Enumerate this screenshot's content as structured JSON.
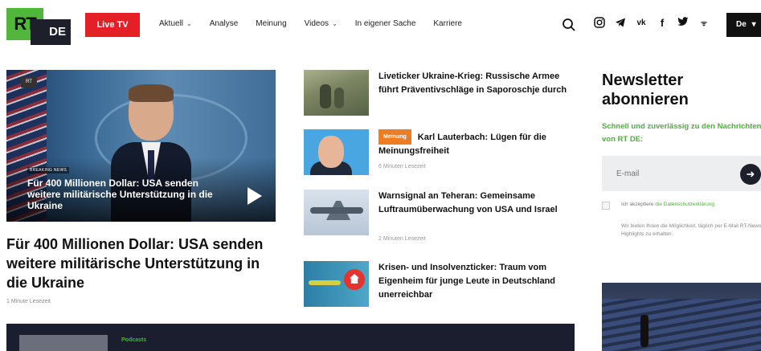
{
  "header": {
    "logo_rt": "RT",
    "logo_de": "DE",
    "live_tv": "Live TV",
    "nav": [
      {
        "label": "Aktuell",
        "dropdown": true
      },
      {
        "label": "Analyse",
        "dropdown": false
      },
      {
        "label": "Meinung",
        "dropdown": false
      },
      {
        "label": "Videos",
        "dropdown": true
      },
      {
        "label": "In eigener Sache",
        "dropdown": false
      },
      {
        "label": "Karriere",
        "dropdown": false
      }
    ],
    "social_icons": [
      "instagram-icon",
      "telegram-icon",
      "vk-icon",
      "facebook-icon",
      "twitter-icon",
      "rss-icon"
    ],
    "language": "De"
  },
  "hero": {
    "category": "BREAKING NEWS",
    "caption": "Für 400 Millionen Dollar: USA senden weitere militärische Unterstützung in die Ukraine",
    "title": "Für 400 Millionen Dollar: USA senden weitere militärische Unterstützung in die Ukraine",
    "read_time": "1 Minute Lesezeit"
  },
  "articles": [
    {
      "title": "Liveticker Ukraine-Krieg: Russische Armee führt Präventivschläge in Saporoschje durch",
      "meta": "",
      "badge": ""
    },
    {
      "title": "Karl Lauterbach: Lügen für die Meinungsfreiheit",
      "meta": "6 Minuten Lesezeit",
      "badge": "Meinung"
    },
    {
      "title": "Warnsignal an Teheran: Gemeinsame Luftraumüberwachung von USA und Israel",
      "meta": "2 Minuten Lesezeit",
      "badge": ""
    },
    {
      "title": "Krisen- und Insolvenzticker: Traum vom Eigenheim für junge Leute in Deutschland unerreichbar",
      "meta": "",
      "badge": ""
    }
  ],
  "newsletter": {
    "title": "Newsletter abonnieren",
    "subtitle": "Schnell und zuverlässig zu den Nachrichten von RT DE:",
    "email_placeholder": "E-mail",
    "accept_prefix": "Ich akzeptiere ",
    "accept_link": "die Datenschutzerklärung",
    "info": "Wir bieten Ihnen die Möglichkeit, täglich per E-Mail RT-News-Highlights zu erhalten."
  },
  "podcast": {
    "label": "Podcasts"
  },
  "colors": {
    "brand_green": "#52b63c",
    "live_red": "#e41f26",
    "badge_orange": "#f07c22",
    "dark": "#1d1f2a"
  }
}
